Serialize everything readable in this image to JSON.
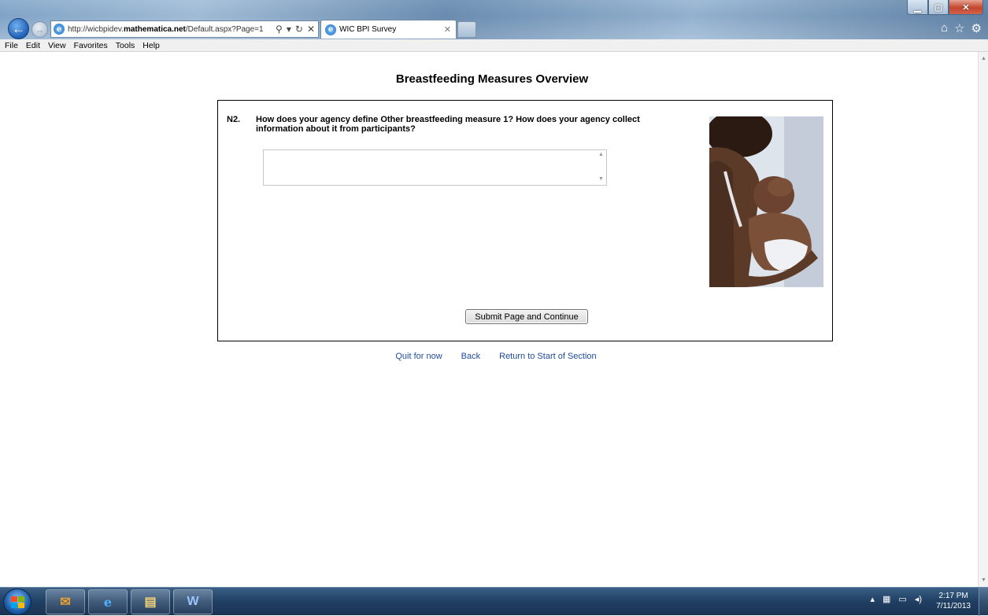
{
  "browser": {
    "url_prefix": "http://wicbpidev.",
    "url_domain": "mathematica.net",
    "url_suffix": "/Default.aspx?Page=1",
    "tab_title": "WIC BPI Survey",
    "menu": [
      "File",
      "Edit",
      "View",
      "Favorites",
      "Tools",
      "Help"
    ]
  },
  "page": {
    "title": "Breastfeeding Measures Overview",
    "question_number": "N2.",
    "question_text": "How does your agency define Other breastfeeding measure 1? How does your agency collect information about it from participants?",
    "answer_value": "",
    "submit_label": "Submit Page and Continue",
    "links": [
      "Quit for now",
      "Back",
      "Return to Start of Section"
    ]
  },
  "taskbar": {
    "time": "2:17 PM",
    "date": "7/11/2013"
  },
  "colors": {
    "link": "#1f4a9c",
    "taskbar": "#203f63"
  }
}
